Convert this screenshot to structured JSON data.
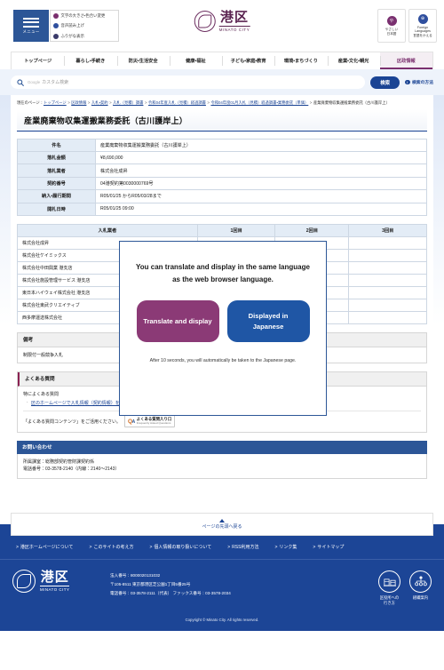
{
  "header": {
    "menu_label": "メニュー",
    "accessibility": [
      {
        "label": "文字の大きさ・色合い変更",
        "icon": "contrast-icon"
      },
      {
        "label": "音声読み上げ",
        "icon": "speaker-icon"
      },
      {
        "label": "ふりがな表示",
        "icon": "furigana-icon"
      }
    ],
    "logo_jp": "港区",
    "logo_en": "MINATO CITY",
    "lang_buttons": [
      {
        "mark": "や",
        "line1": "やさしい",
        "line2": "日本語",
        "icon": "easy-japanese-icon"
      },
      {
        "mark": "⊕",
        "line1": "Foreign",
        "line2": "Languages",
        "line3": "言語をかえる",
        "icon": "globe-icon"
      }
    ]
  },
  "gnav": [
    {
      "label": "トップページ",
      "active": false
    },
    {
      "label": "暮らし・手続き",
      "active": false
    },
    {
      "label": "防災・生活安全",
      "active": false
    },
    {
      "label": "健康・福祉",
      "active": false
    },
    {
      "label": "子ども・家庭・教育",
      "active": false
    },
    {
      "label": "環境・まちづくり",
      "active": false
    },
    {
      "label": "産業・文化・観光",
      "active": false
    },
    {
      "label": "区政情報",
      "active": true
    }
  ],
  "search": {
    "google_label": "Google",
    "placeholder": "カスタム検索",
    "button_label": "検索",
    "how_label": "検索の方法",
    "how_icon": "info-icon"
  },
  "breadcrumb": {
    "prefix": "現在のページ：",
    "items": [
      "トップページ",
      "区政情報",
      "入札・契約",
      "入札（見積）調書",
      "令和04年度入札（見積）経過調書",
      "令和04年度01月入札（見積）経過調書・業務委託（単価）"
    ],
    "current": "産業廃棄物収集運搬業務委託（古川護岸上）"
  },
  "page_title": "産業廃棄物収集運搬業務委託（古川護岸上）",
  "detail_table": {
    "rows": [
      {
        "label": "件名",
        "value": "産業廃棄物収集運搬業務委託（古川護岸上）"
      },
      {
        "label": "落札金額",
        "value": "¥8,690,000"
      },
      {
        "label": "落札業者",
        "value": "株式会社成昇"
      },
      {
        "label": "契約番号",
        "value": "04港契約第0030000769号"
      },
      {
        "label": "納入・履行期間",
        "value": "R05/01/25 からR05/03/28まで"
      },
      {
        "label": "開札日時",
        "value": "R05/01/25 09:00"
      }
    ]
  },
  "bid_table": {
    "headers": [
      "入札業者",
      "1回目",
      "2回目",
      "3回目"
    ],
    "rows": [
      {
        "name": "株式会社成昇",
        "r1": "",
        "r2": "",
        "r3": ""
      },
      {
        "name": "株式会社ケイミックス",
        "r1": "",
        "r2": "",
        "r3": ""
      },
      {
        "name": "株式会社中田興業 港支店",
        "r1": "",
        "r2": "",
        "r3": ""
      },
      {
        "name": "株式会社施設管理サービス 港支店",
        "r1": "",
        "r2": "",
        "r3": ""
      },
      {
        "name": "東日本ハイウェイ株式会社 港支店",
        "r1": "",
        "r2": "",
        "r3": ""
      },
      {
        "name": "株式会社東武クリエイティブ",
        "r1": "",
        "r2": "",
        "r3": ""
      },
      {
        "name": "西多摩運送株式会社",
        "r1": "",
        "r2": "",
        "r3": ""
      }
    ]
  },
  "remarks": {
    "heading": "備考",
    "text": "制限付一般競争入札"
  },
  "faq": {
    "heading": "よくある質問",
    "lead": "特によくある質問",
    "links": [
      "区のホームページで入札情報（契約情報）を知りたい。"
    ],
    "cta_text": "「よくある質問コンテンツ」をご活用ください。",
    "badge_mark": "Q",
    "badge_mark_sub": "A",
    "badge_title": "よくある質問入り口",
    "badge_sub": "Frequently Asked Questions"
  },
  "contact": {
    "heading": "お問い合わせ",
    "lines": [
      "所属課室：総務部契約管財課契約係",
      "電話番号：03-3578-2140（内線：2140～2143）"
    ]
  },
  "pagetop": {
    "label": "ページの先頭へ戻る",
    "icon": "arrow-up-icon"
  },
  "footer": {
    "links": [
      "港区ホームページについて",
      "このサイトの考え方",
      "個人情報の取り扱いについて",
      "RSS利用方法",
      "リンク集",
      "サイトマップ"
    ],
    "logo_jp": "港区",
    "logo_en": "MINATO CITY",
    "address": [
      "法人番号：8000020131032",
      "〒105-8511 東京都港区芝公園1丁目5番25号",
      "電話番号：03-3578-2111（代表） ファックス番号：03-3578-2034"
    ],
    "icons": [
      {
        "label": "区役所への\n行き方",
        "line1": "区役所への",
        "line2": "行き方",
        "icon": "building-icon"
      },
      {
        "label": "組織案内",
        "line1": "組織案内",
        "line2": "",
        "icon": "org-chart-icon"
      }
    ],
    "copyright": "Copyright © Minato City. All rights reserved."
  },
  "modal": {
    "message": "You can translate and display in the same language as the web browser language.",
    "translate_button": "Translate and display",
    "japanese_button": "Displayed in Japanese",
    "note": "After 10 seconds, you will automatically be taken to the Japanese page."
  },
  "colors": {
    "brand_blue": "#1c4596",
    "nav_blue": "#2c5697",
    "accent_purple": "#7a2f6e",
    "modal_purple": "#8b3a76",
    "modal_blue": "#1f56a5",
    "table_header": "#e3ecf6"
  }
}
